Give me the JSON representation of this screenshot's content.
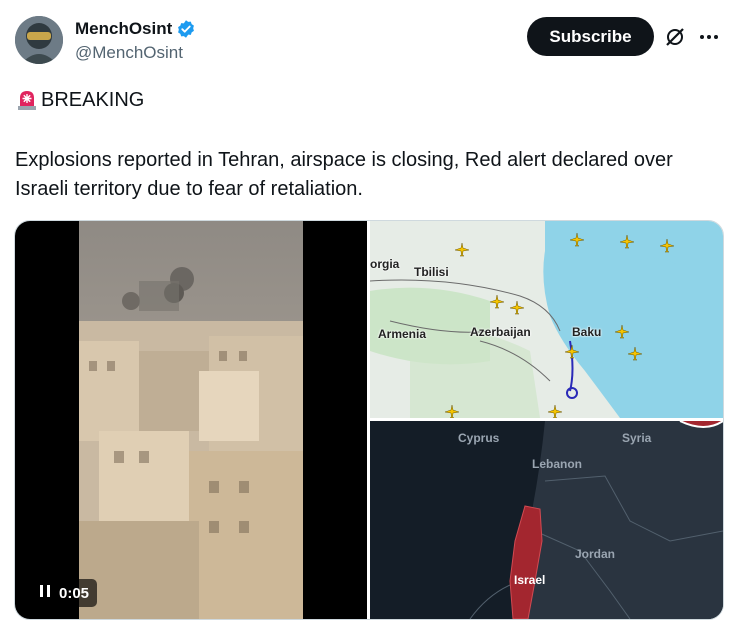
{
  "author": {
    "display_name": "MenchOsint",
    "handle": "@MenchOsint",
    "verified_icon": "verified-badge-icon"
  },
  "actions": {
    "subscribe_label": "Subscribe"
  },
  "post": {
    "headline": "BREAKING",
    "headline_icon": "rotating-light-icon",
    "body": "Explosions reported in Tehran, airspace is closing, Red alert declared over Israeli territory due to fear of retaliation."
  },
  "video": {
    "time": "0:05",
    "pause_icon": "pause-icon"
  },
  "map_flight": {
    "labels": [
      "orgia",
      "Tbilisi",
      "Armenia",
      "Azerbaijan",
      "Baku"
    ]
  },
  "map_alert": {
    "labels": [
      "Cyprus",
      "Syria",
      "Lebanon",
      "Jordan",
      "Israel"
    ]
  },
  "colors": {
    "accent": "#0f1419",
    "verified_blue": "#1d9bf0",
    "sea_blue": "#8fd3e8",
    "alert_red": "#a3262f"
  }
}
